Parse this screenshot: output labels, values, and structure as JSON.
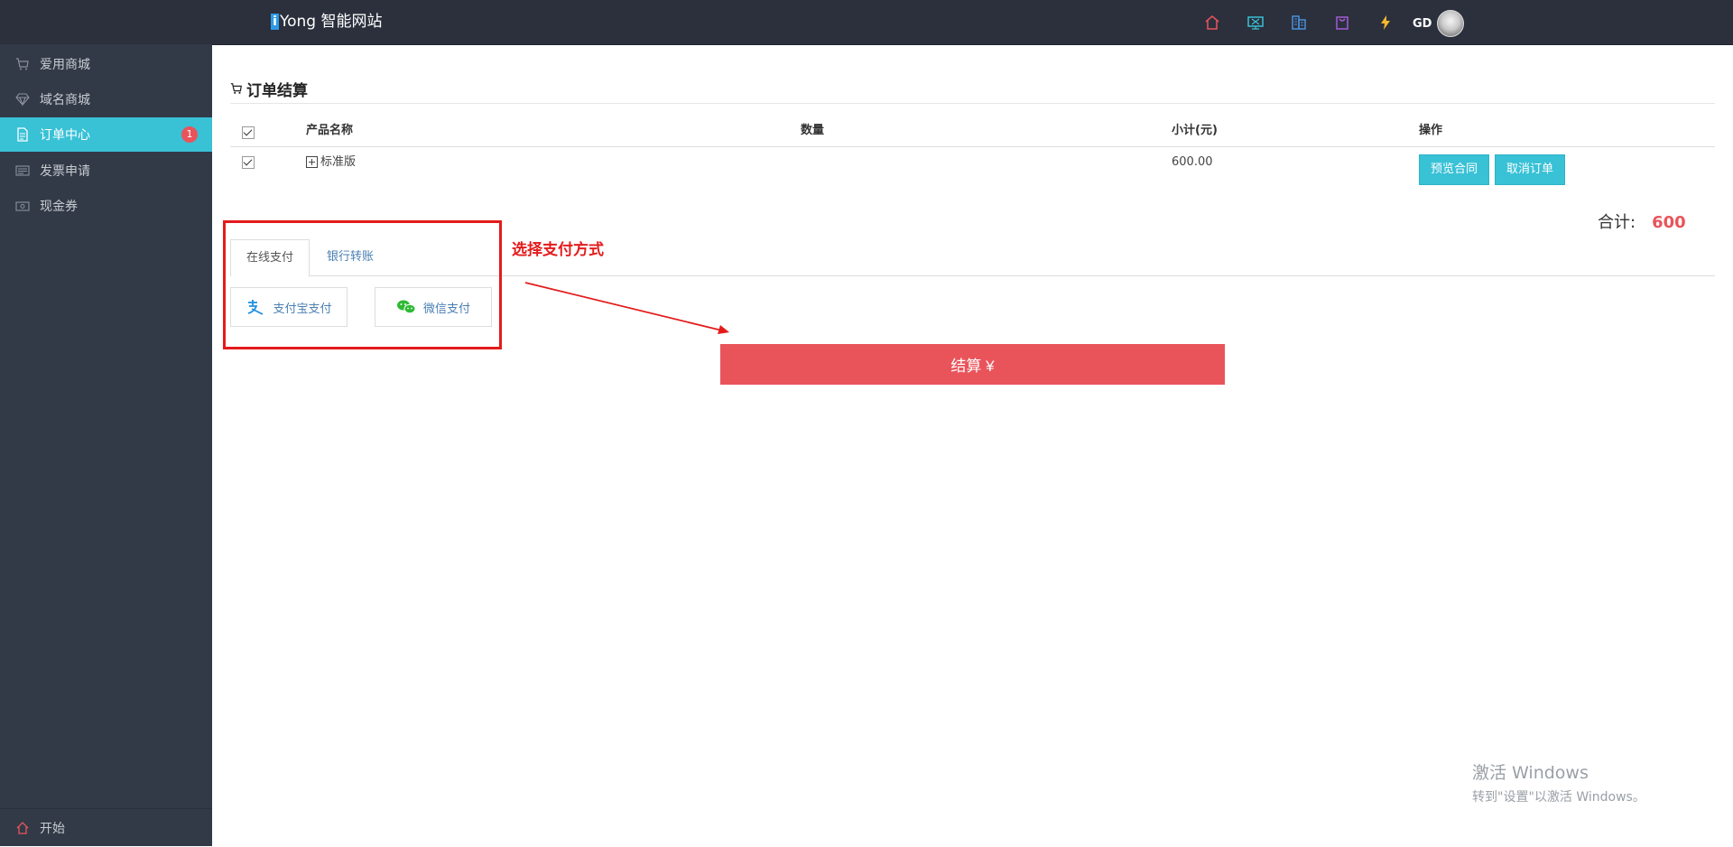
{
  "header": {
    "brand_mark": "i",
    "brand_name": "Yong 智能网站",
    "icons": [
      "home-icon",
      "monitor-icon",
      "building-icon",
      "shopping-bag-icon",
      "lightning-icon"
    ],
    "user_initials": "GD"
  },
  "sidebar": {
    "items": [
      {
        "label": "爱用商城",
        "icon": "cart-icon"
      },
      {
        "label": "域名商城",
        "icon": "diamond-icon"
      },
      {
        "label": "订单中心",
        "icon": "document-icon",
        "badge": "1",
        "active": true
      },
      {
        "label": "发票申请",
        "icon": "invoice-icon"
      },
      {
        "label": "现金券",
        "icon": "cash-icon"
      }
    ],
    "bottom_label": "开始"
  },
  "section": {
    "title": "订单结算"
  },
  "table": {
    "headers": [
      "产品名称",
      "数量",
      "小计(元)",
      "操作"
    ],
    "rows": [
      {
        "product": "标准版",
        "quantity": "",
        "subtotal": "600.00",
        "actions": [
          "预览合同",
          "取消订单"
        ]
      }
    ]
  },
  "total": {
    "label": "合计:",
    "amount": "600"
  },
  "payment": {
    "tabs": [
      "在线支付",
      "银行转账"
    ],
    "active_tab": 0,
    "methods": [
      "支付宝支付",
      "微信支付"
    ]
  },
  "annotation": {
    "text": "选择支付方式",
    "color": "#e41b1b"
  },
  "checkout": {
    "label": "结算 ¥"
  },
  "colors": {
    "accent": "#39c1d6",
    "danger": "#e9545b",
    "sidebar_bg": "#323a47",
    "topbar_bg": "#2b303c"
  },
  "watermark": {
    "line1": "激活 Windows",
    "line2": "转到\"设置\"以激活 Windows。"
  }
}
